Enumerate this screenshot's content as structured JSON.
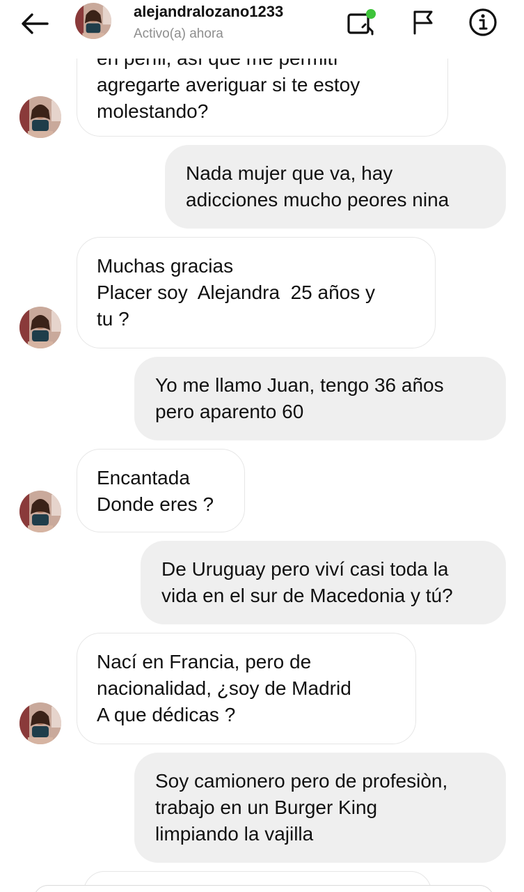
{
  "header": {
    "username": "alejandralozano1233",
    "status": "Activo(a) ahora",
    "back_icon": "arrow-left-icon",
    "video_icon": "video-call-icon",
    "flag_icon": "flag-icon",
    "info_icon": "info-icon",
    "online_color": "#3ec43a"
  },
  "messages": [
    {
      "sender": "them",
      "lines": [
        "en perfil, así que me permití",
        "agregarte averiguar si te estoy",
        "molestando?"
      ]
    },
    {
      "sender": "me",
      "lines": [
        "Nada mujer que va, hay",
        "adicciones mucho peores nina"
      ]
    },
    {
      "sender": "them",
      "lines": [
        "Muchas gracias",
        "Placer soy  Alejandra  25 años y",
        "tu ?"
      ]
    },
    {
      "sender": "me",
      "lines": [
        "Yo me llamo Juan, tengo 36 años",
        "pero aparento 60"
      ]
    },
    {
      "sender": "them",
      "lines": [
        "Encantada",
        "Donde eres ?"
      ]
    },
    {
      "sender": "me",
      "lines": [
        "De Uruguay pero viví casi toda la",
        "vida en el sur de Macedonia y tú?"
      ]
    },
    {
      "sender": "them",
      "lines": [
        "Nací en Francia, pero de",
        "nacionalidad, ¿soy de Madrid",
        "A que dédicas ?"
      ]
    },
    {
      "sender": "me",
      "lines": [
        "Soy camionero pero de profesiòn,",
        "trabajo en un Burger King",
        "limpiando la vajilla"
      ]
    }
  ]
}
